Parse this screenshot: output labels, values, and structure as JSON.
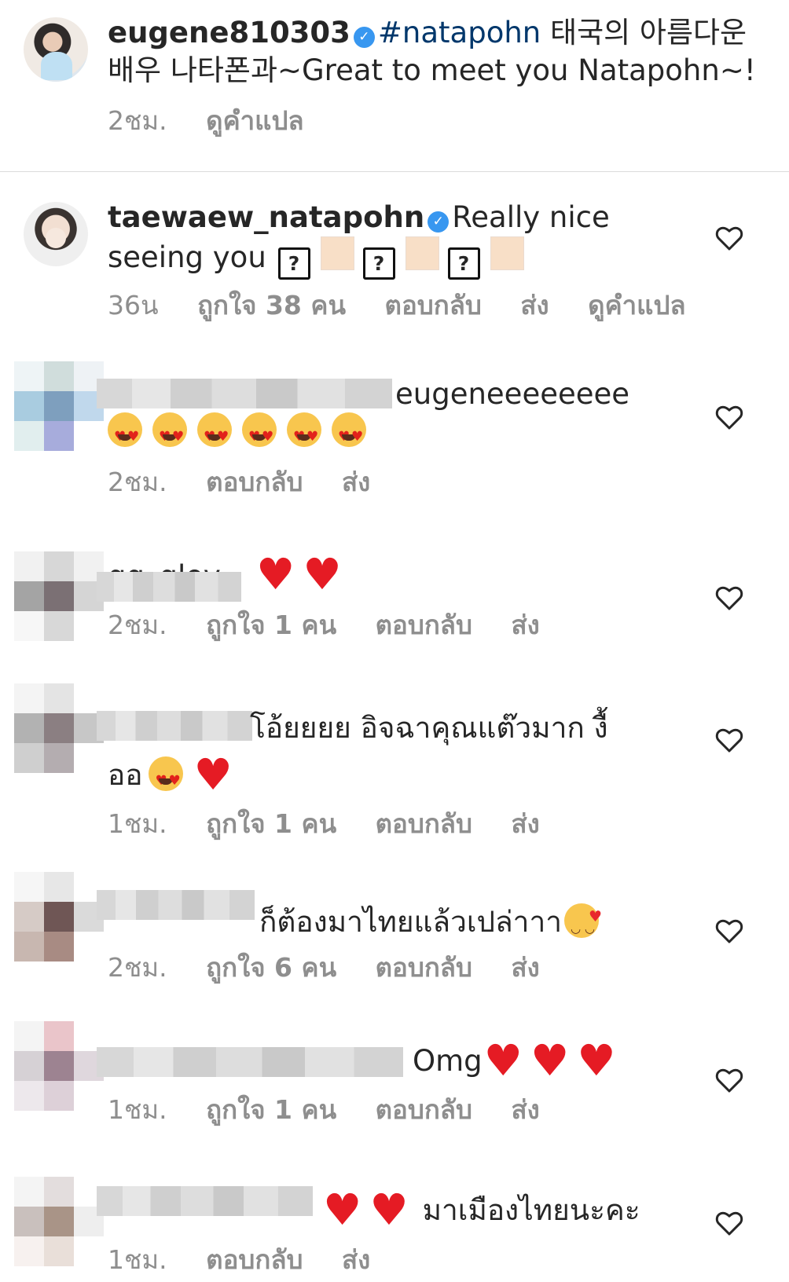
{
  "caption": {
    "username": "eugene810303",
    "verified_icon": "✓",
    "hashtag": "#natapohn",
    "text_line1_rest": " 태국의 아름다운",
    "text_line2": "배우 나타폰과~Great to meet you Natapohn~!",
    "time": "2ชม.",
    "translate": "ดูคำแปล"
  },
  "comments": [
    {
      "username": "taewaew_natapohn",
      "verified_icon": "✓",
      "text_line1": "Really nice",
      "text_line2": "seeing you",
      "unsupported_glyph": "?",
      "time": "36น",
      "likes": "ถูกใจ 38 คน",
      "reply": "ตอบกลับ",
      "send": "ส่ง",
      "translate": "ดูคำแปล",
      "like_icon": "heart-outline-icon"
    },
    {
      "visible_text": "eugeneeeeeeee",
      "emoji_count": 6,
      "time": "2ชม.",
      "reply": "ตอบกลับ",
      "send": "ส่ง",
      "like_icon": "heart-outline-icon"
    },
    {
      "visible_username_fragment": "gg_glov",
      "time": "2ชม.",
      "likes": "ถูกใจ 1 คน",
      "reply": "ตอบกลับ",
      "send": "ส่ง",
      "like_icon": "heart-outline-icon"
    },
    {
      "visible_text_line1": "โอ้ยยยย อิจฉาคุณแต๊วมาก งื้",
      "visible_text_line2": "ออ",
      "time": "1ชม.",
      "likes": "ถูกใจ 1 คน",
      "reply": "ตอบกลับ",
      "send": "ส่ง",
      "like_icon": "heart-outline-icon"
    },
    {
      "visible_text": "ก็ต้องมาไทยแล้วเปล่าาา",
      "time": "2ชม.",
      "likes": "ถูกใจ 6 คน",
      "reply": "ตอบกลับ",
      "send": "ส่ง",
      "like_icon": "heart-outline-icon"
    },
    {
      "visible_text": "Omg",
      "time": "1ชม.",
      "likes": "ถูกใจ 1 คน",
      "reply": "ตอบกลับ",
      "send": "ส่ง",
      "like_icon": "heart-outline-icon"
    },
    {
      "visible_text": "มาเมืองไทยนะคะ",
      "time": "1ชม.",
      "reply": "ตอบกลับ",
      "send": "ส่ง",
      "like_icon": "heart-outline-icon"
    }
  ],
  "colors": {
    "text": "#262626",
    "secondary_text": "#8e8e8e",
    "hashtag": "#00376b",
    "verified": "#3897f0",
    "divider": "#dbdbdb",
    "red_heart": "#e51b24"
  }
}
